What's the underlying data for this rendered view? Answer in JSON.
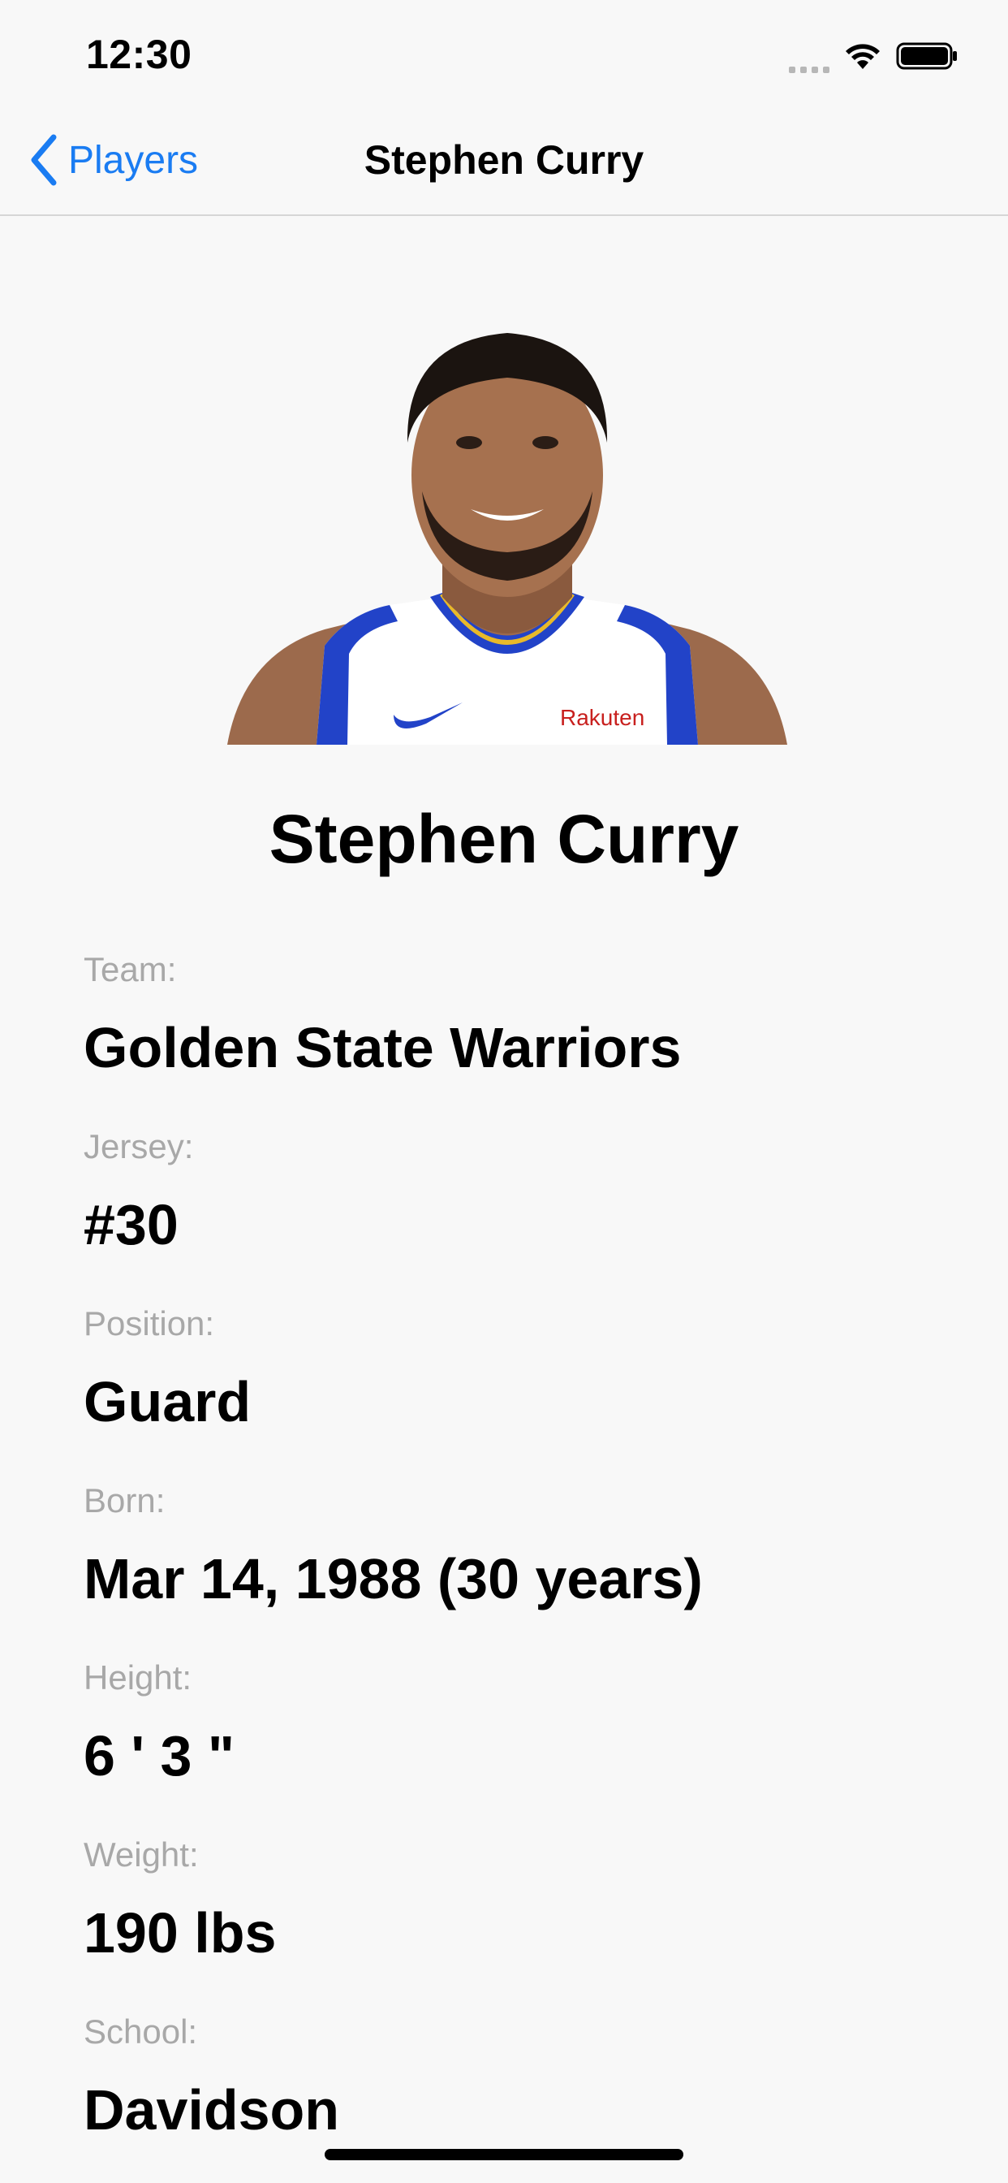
{
  "status_bar": {
    "time": "12:30",
    "icons": [
      "signal-dots-icon",
      "wifi-icon",
      "battery-icon"
    ]
  },
  "nav": {
    "back_label": "Players",
    "title": "Stephen Curry"
  },
  "player": {
    "photo_description": "player-headshot",
    "name": "Stephen Curry",
    "fields": [
      {
        "label": "Team:",
        "value": "Golden State Warriors"
      },
      {
        "label": "Jersey:",
        "value": "#30"
      },
      {
        "label": "Position:",
        "value": "Guard"
      },
      {
        "label": "Born:",
        "value": "Mar 14, 1988 (30 years)"
      },
      {
        "label": "Height:",
        "value": "6 ' 3 \""
      },
      {
        "label": "Weight:",
        "value": "190 lbs"
      },
      {
        "label": "School:",
        "value": "Davidson"
      }
    ]
  },
  "jersey_text": "Rakuten",
  "colors": {
    "accent": "#1a7cf2",
    "label_gray": "#a8a8a8",
    "background": "#f8f8f8"
  }
}
